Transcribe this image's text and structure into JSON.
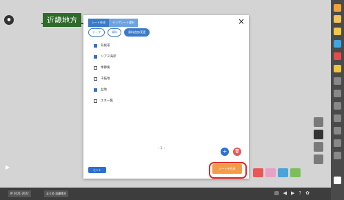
{
  "board": {
    "title": "近畿地方",
    "home_label": "ホーム"
  },
  "dialog": {
    "tabs": [
      "シート作成",
      "テンプレート選択"
    ],
    "close": "×",
    "subtabs": [
      "テーマ",
      "資料",
      "資料追加/変更"
    ],
    "items": [
      {
        "label": "気候帯",
        "checked": true
      },
      {
        "label": "リアス海岸",
        "checked": true
      },
      {
        "label": "季節風",
        "checked": false
      },
      {
        "label": "干拓地",
        "checked": false
      },
      {
        "label": "盆地",
        "checked": true
      },
      {
        "label": "エネ一覧",
        "checked": false
      }
    ],
    "pager": "‹ 1 ›",
    "hint_label": "ヒント",
    "create_label": "シートを作成"
  },
  "bottom": {
    "left": "IP 2021-2022",
    "tab": "まとめ 近畿地方"
  },
  "colors": {
    "accent": "#2e6fd0",
    "highlight": "#e52323",
    "create": "#f39c4a"
  }
}
